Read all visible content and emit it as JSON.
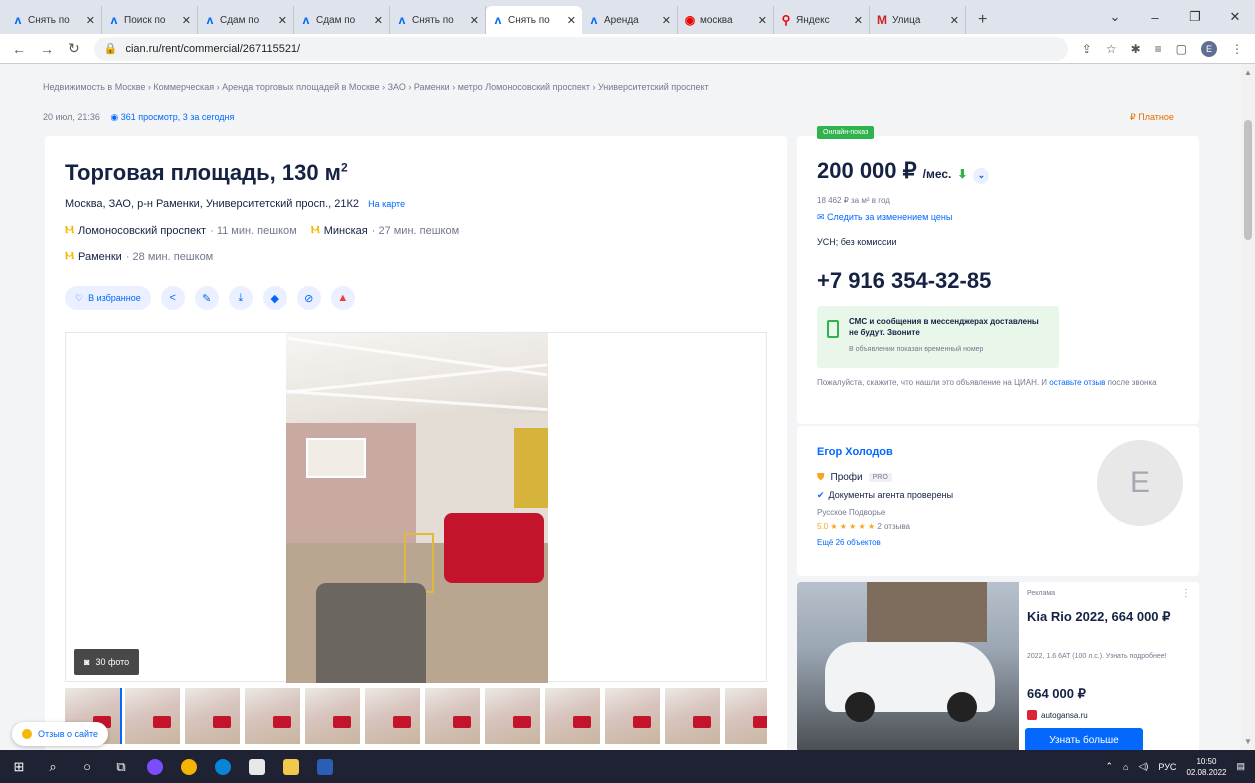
{
  "browser": {
    "tabs": [
      {
        "icon": "cian-icon",
        "title": "Снять по"
      },
      {
        "icon": "cian-icon",
        "title": "Поиск по"
      },
      {
        "icon": "cian-icon",
        "title": "Сдам по"
      },
      {
        "icon": "cian-icon",
        "title": "Сдам по"
      },
      {
        "icon": "cian-icon",
        "title": "Снять по"
      },
      {
        "icon": "cian-icon",
        "title": "Снять по",
        "active": true
      },
      {
        "icon": "cian-icon",
        "title": "Аренда"
      },
      {
        "icon": "opera-icon",
        "title": "москва"
      },
      {
        "icon": "yandex-maps-icon",
        "title": "Яндекс"
      },
      {
        "icon": "gmail-icon",
        "title": "Улица"
      }
    ],
    "new_tab": "+",
    "url": "cian.ru/rent/commercial/267115521/"
  },
  "breadcrumbs": "Недвижимость в Москве  ›  Коммерческая  ›  Аренда торговых площадей в Москве  ›  ЗАО  ›  Раменки  ›  метро Ломоносовский проспект  ›  Университетский проспект",
  "meta": {
    "date": "20 июл, 21:36",
    "views": "361 просмотр, 3 за сегодня",
    "paid": "Платное"
  },
  "listing": {
    "title": "Торговая площадь, 130 м",
    "title_sup": "2",
    "address": "Москва, ЗАО, р-н Раменки, Университетский просп., 21К2",
    "map_link": "На карте",
    "metro": [
      {
        "station": "Ломоносовский проспект",
        "walk": "· 11 мин. пешком"
      },
      {
        "station": "Минская",
        "walk": "· 27 мин. пешком"
      },
      {
        "station": "Раменки",
        "walk": "· 28 мин. пешком"
      }
    ],
    "favorite": "В избранное",
    "photo_count": "30 фото"
  },
  "price": {
    "online_badge": "Онлайн-показ",
    "value": "200 000 ₽",
    "per": "/мес.",
    "sub": "18 462 ₽ за м² в год",
    "follow": "Следить за изменением цены",
    "tax": "УСН; без комиссии",
    "phone": "+7 916 354-32-85",
    "sms_title": "СМС и сообщения в мессенджерах доставлены не будут. Звоните",
    "sms_note": "В объявлении показан временный номер",
    "please": "Пожалуйста, скажите, что нашли это объявление на ЦИАН. И ",
    "please_link": "оставьте отзыв",
    "please_end": " после звонка"
  },
  "agent": {
    "name": "Егор Холодов",
    "status": "Профи",
    "pro_badge": "PRO",
    "docs": "Документы агента проверены",
    "company": "Русское Подворье",
    "rating_score": "5.0",
    "stars": "★ ★ ★ ★ ★",
    "reviews": "2 отзыва",
    "more": "Ещё 26 объектов",
    "avatar_letter": "E"
  },
  "ad": {
    "label": "Реклама",
    "title": "Kia Rio 2022, 664 000 ₽",
    "desc": "2022, 1.6 6AT (100 л.с.). Узнать подробнее!",
    "price": "664 000 ₽",
    "site": "autogansa.ru",
    "button": "Узнать больше"
  },
  "feedback": "Отзыв о сайте",
  "taskbar": {
    "lang": "РУС",
    "time": "10:50",
    "date": "02.08.2022"
  }
}
